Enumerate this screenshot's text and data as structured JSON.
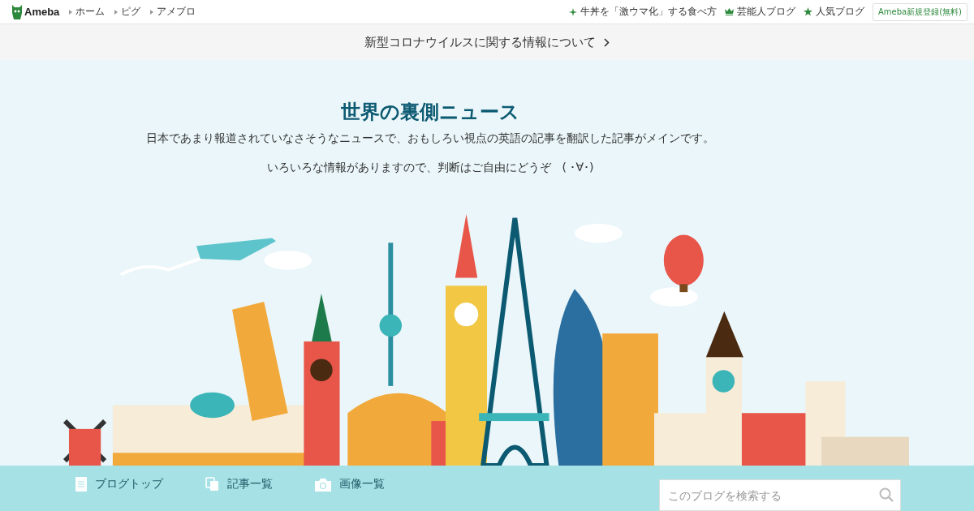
{
  "header": {
    "logo": "Ameba",
    "links": [
      "ホーム",
      "ピグ",
      "アメブロ"
    ],
    "promos": [
      {
        "kind": "sparkle",
        "label": "牛丼を「激ウマ化」する食べ方"
      },
      {
        "kind": "crown",
        "label": "芸能人ブログ"
      },
      {
        "kind": "star",
        "label": "人気ブログ"
      }
    ],
    "signup": "Ameba新規登録(無料)"
  },
  "notice": "新型コロナウイルスに関する情報について",
  "blog": {
    "title": "世界の裏側ニュース",
    "description": "日本であまり報道されていなさそうなニュースで、おもしろい視点の英語の記事を翻訳した記事がメインです。",
    "note": "いろいろな情報がありますので、判断はご自由にどうぞ　( ･∀･)"
  },
  "nav": {
    "items": [
      {
        "kind": "page",
        "label": "ブログトップ"
      },
      {
        "kind": "copy",
        "label": "記事一覧"
      },
      {
        "kind": "camera",
        "label": "画像一覧"
      }
    ],
    "search": {
      "placeholder": "このブログを検索する"
    }
  }
}
